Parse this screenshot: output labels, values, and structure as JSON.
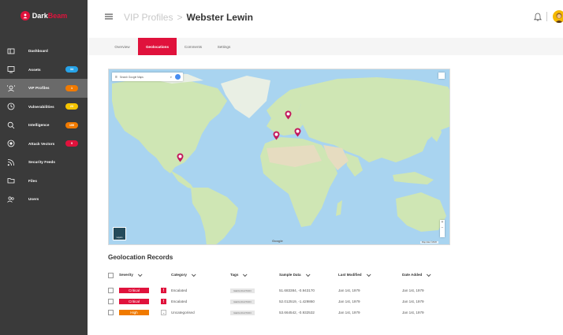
{
  "app": {
    "logo_prefix": "Dark",
    "logo_suffix": "Beam",
    "brand_color": "#e0123c"
  },
  "sidebar": {
    "items": [
      {
        "label": "Dashboard",
        "icon": "dashboard-icon",
        "badge": null,
        "active": false
      },
      {
        "label": "Assets",
        "icon": "monitor-icon",
        "badge": "34",
        "badge_color": "#27a3e8",
        "active": false
      },
      {
        "label": "VIP Profiles",
        "icon": "vip-profile-icon",
        "badge": "1",
        "badge_color": "#f07a00",
        "active": true
      },
      {
        "label": "Vulnerabilities",
        "icon": "clock-icon",
        "badge": "23",
        "badge_color": "#f5c400",
        "active": false
      },
      {
        "label": "Intelligence",
        "icon": "search-icon",
        "badge": "199",
        "badge_color": "#f07a00",
        "active": false
      },
      {
        "label": "Attack Vectors",
        "icon": "target-icon",
        "badge": "9",
        "badge_color": "#e0123c",
        "active": false
      },
      {
        "label": "Security Feeds",
        "icon": "rss-icon",
        "badge": null,
        "active": false
      },
      {
        "label": "Files",
        "icon": "folder-icon",
        "badge": null,
        "active": false
      },
      {
        "label": "Users",
        "icon": "users-icon",
        "badge": null,
        "active": false
      }
    ]
  },
  "header": {
    "section": "VIP Profiles",
    "separator": ">",
    "current": "Webster Lewin"
  },
  "tabs": [
    {
      "label": "Overview",
      "active": false
    },
    {
      "label": "Geolocations",
      "active": true
    },
    {
      "label": "Comments",
      "active": false
    },
    {
      "label": "Settings",
      "active": false
    }
  ],
  "map": {
    "search_placeholder": "Search Google Maps",
    "layers_label": "Layers",
    "google_label": "Google",
    "attribution": "Map data ©2020",
    "ocean_color": "#a9d4f0",
    "land_color": "#cfe6b4"
  },
  "records": {
    "title": "Geolocation Records",
    "columns": [
      "Severity",
      "Category",
      "Tags",
      "Sample Data",
      "Last Modified",
      "Date Added"
    ],
    "rows": [
      {
        "severity": "Critical",
        "severity_color": "#e0123c",
        "category": "Escalated",
        "category_icon": "exclamation-icon",
        "tag": "GEOLOCATION",
        "sample": "51.683384, -0.943170",
        "modified": "Jan 1st, 1979",
        "added": "Jan 1st, 1979"
      },
      {
        "severity": "Critical",
        "severity_color": "#e0123c",
        "category": "Escalated",
        "category_icon": "exclamation-icon",
        "tag": "GEOLOCATION",
        "sample": "52.012519, -1.429860",
        "modified": "Jan 1st, 1979",
        "added": "Jan 1st, 1979"
      },
      {
        "severity": "High",
        "severity_color": "#f07a00",
        "category": "Uncategorised",
        "category_icon": "chevron-down-icon",
        "tag": "GEOLOCATION",
        "sample": "53.664542, -0.932532",
        "modified": "Jan 1st, 1979",
        "added": "Jan 1st, 1979"
      }
    ]
  }
}
